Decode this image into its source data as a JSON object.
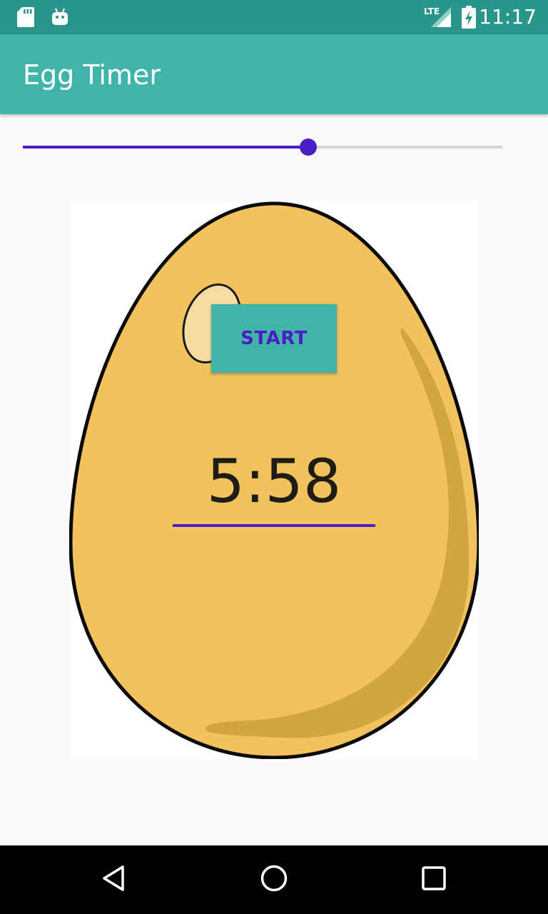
{
  "status_bar": {
    "time": "11:17",
    "network": "LTE",
    "icons": [
      "sd-card-icon",
      "android-icon",
      "lte-signal-icon",
      "battery-charging-icon"
    ]
  },
  "app_bar": {
    "title": "Egg Timer"
  },
  "seekbar": {
    "value_fraction": 0.595
  },
  "start_button": {
    "label": "START"
  },
  "timer": {
    "display": "5:58"
  },
  "nav_bar": {
    "icons": [
      "back-icon",
      "home-icon",
      "recents-icon"
    ]
  },
  "colors": {
    "status_bar": "#2a968b",
    "app_bar": "#41b4aa",
    "accent": "#4c1cc4",
    "egg_fill": "#f2c35d",
    "egg_shade": "#d1a53f",
    "egg_highlight": "#f6dca2"
  }
}
